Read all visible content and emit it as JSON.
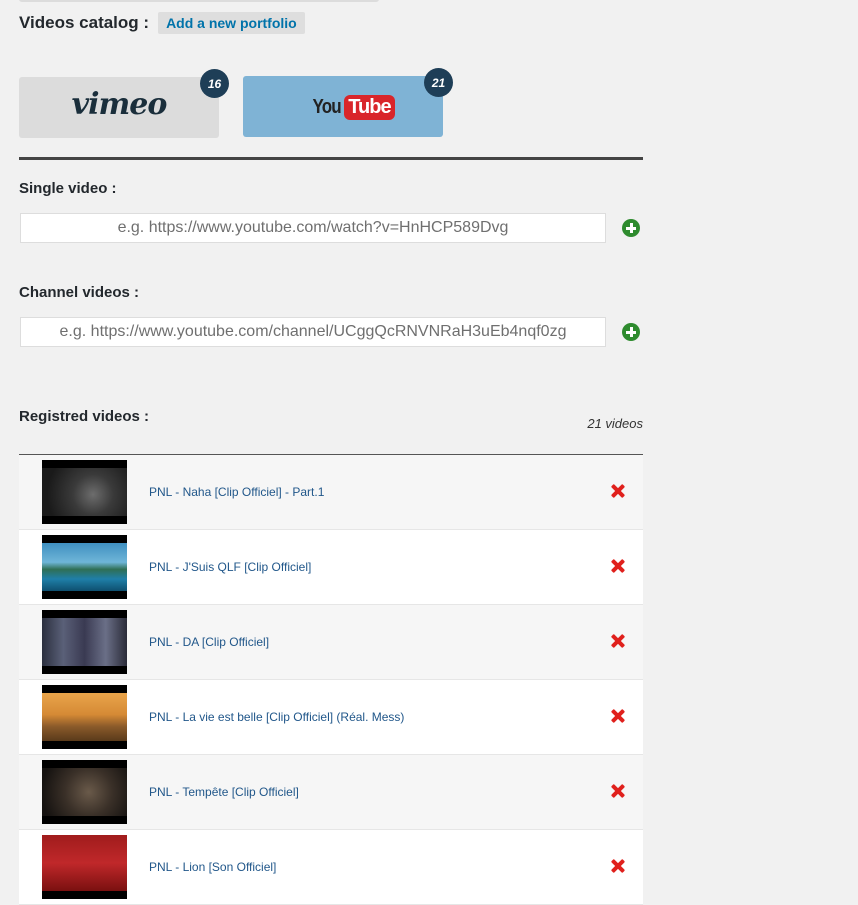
{
  "catalog": {
    "title": "Videos catalog :",
    "add_portfolio_label": "Add a new portfolio"
  },
  "providers": [
    {
      "name": "vimeo",
      "count": "16",
      "selected": false
    },
    {
      "name_you": "You",
      "name_tube": "Tube",
      "count": "21",
      "selected": true
    }
  ],
  "single_video": {
    "label": "Single video :",
    "placeholder": "e.g. https://www.youtube.com/watch?v=HnHCP589Dvg"
  },
  "channel_videos": {
    "label": "Channel videos :",
    "placeholder": "e.g. https://www.youtube.com/channel/UCggQcRNVNRaH3uEb4nqf0zg"
  },
  "registered": {
    "label": "Registred videos :",
    "count_text": "21 videos",
    "videos": [
      {
        "title": "PNL - Naha [Clip Officiel] - Part.1"
      },
      {
        "title": "PNL - J'Suis QLF [Clip Officiel]"
      },
      {
        "title": "PNL - DA [Clip Officiel]"
      },
      {
        "title": "PNL - La vie est belle [Clip Officiel] (Réal. Mess)"
      },
      {
        "title": "PNL - Tempête [Clip Officiel]"
      },
      {
        "title": "PNL - Lion [Son Officiel]"
      }
    ]
  },
  "colors": {
    "accent": "#0073aa",
    "badge": "#1e3e57",
    "youtube_selected_bg": "#7fb3d5",
    "add_green": "#2e8b2e",
    "delete_red": "#e0201c"
  }
}
